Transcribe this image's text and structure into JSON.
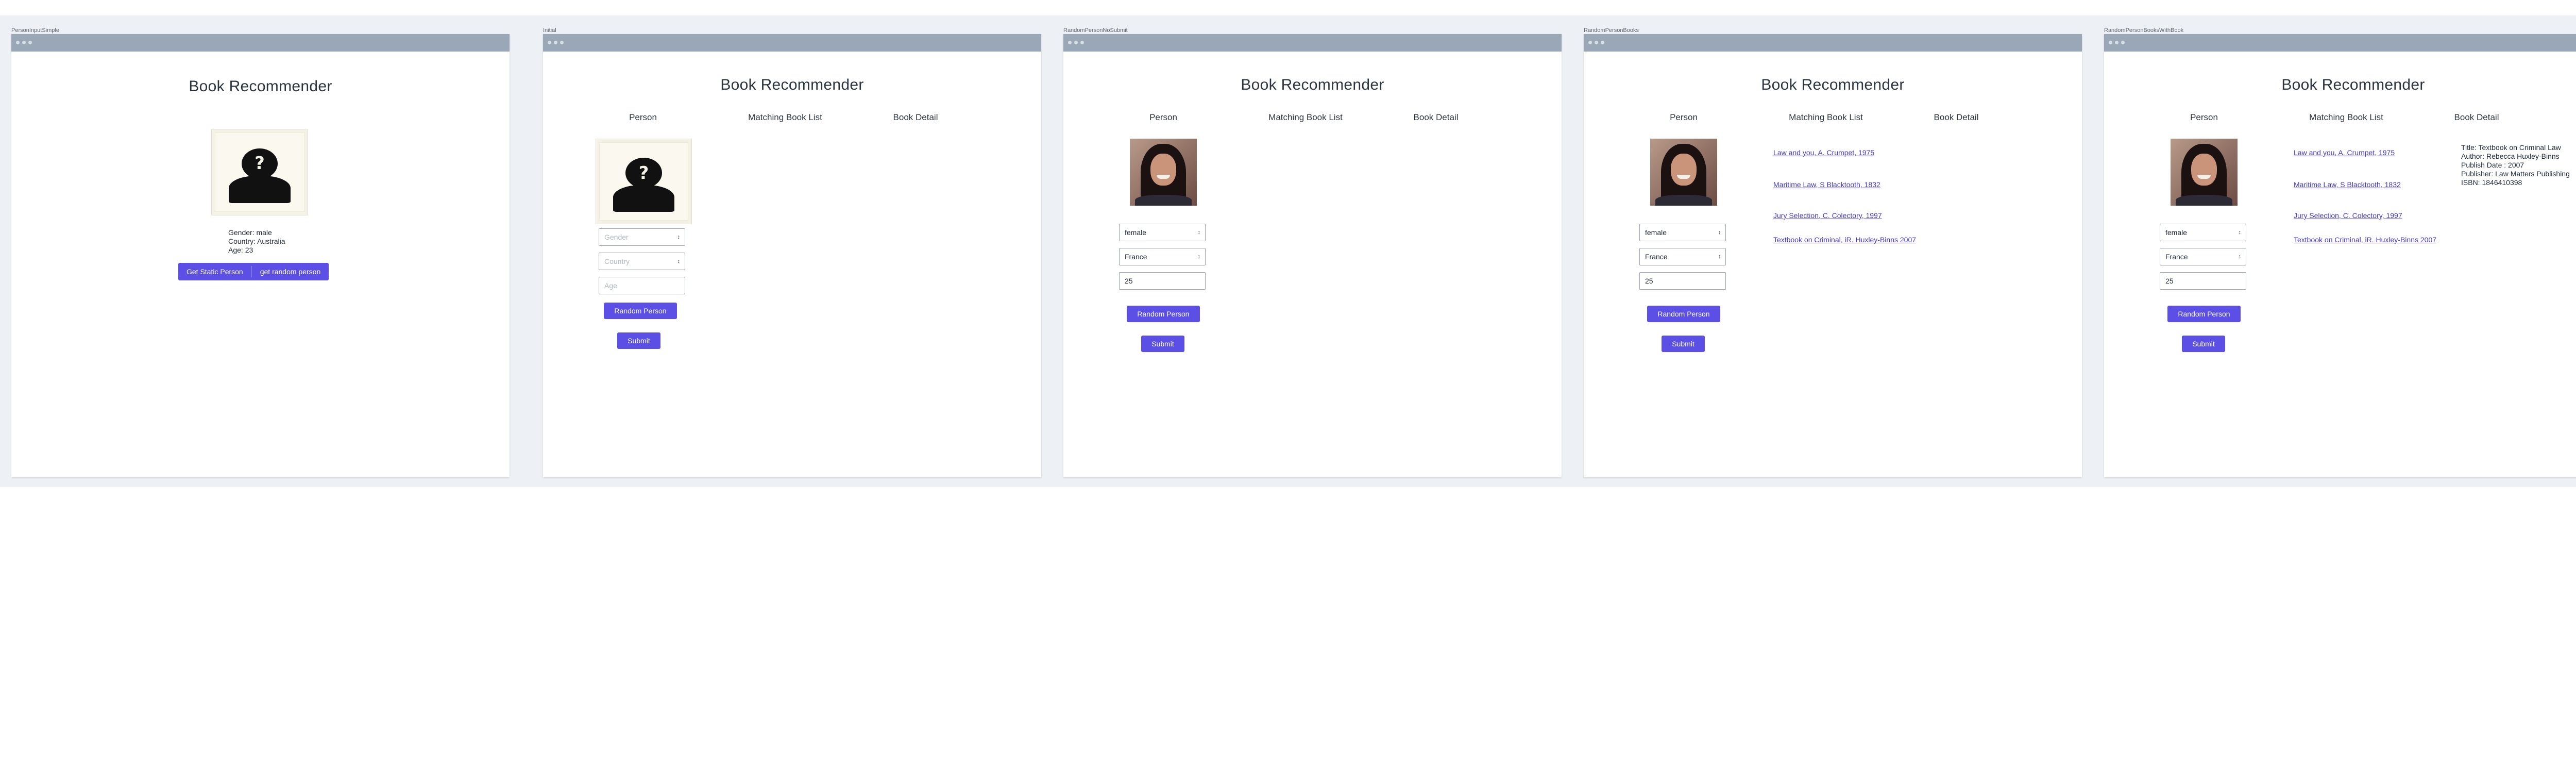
{
  "frames": [
    {
      "label": "PersonInputSimple",
      "title": "Book Recommender",
      "person": {
        "gender_line": "Gender: male",
        "country_line": "Country: Australia",
        "age_line": "Age: 23"
      },
      "buttons": {
        "static": "Get Static Person",
        "random": "get random person"
      }
    },
    {
      "label": "Initial",
      "title": "Book Recommender",
      "headers": {
        "person": "Person",
        "list": "Matching Book List",
        "detail": "Book Detail"
      },
      "form": {
        "gender_placeholder": "Gender",
        "country_placeholder": "Country",
        "age_placeholder": "Age"
      },
      "buttons": {
        "random": "Random Person",
        "submit": "Submit"
      }
    },
    {
      "label": "RandomPersonNoSubmit",
      "title": "Book Recommender",
      "headers": {
        "person": "Person",
        "list": "Matching Book List",
        "detail": "Book Detail"
      },
      "form": {
        "gender": "female",
        "country": "France",
        "age": "25"
      },
      "buttons": {
        "random": "Random Person",
        "submit": "Submit"
      }
    },
    {
      "label": "RandomPersonBooks",
      "title": "Book Recommender",
      "headers": {
        "person": "Person",
        "list": "Matching Book List",
        "detail": "Book Detail"
      },
      "form": {
        "gender": "female",
        "country": "France",
        "age": "25"
      },
      "buttons": {
        "random": "Random Person",
        "submit": "Submit"
      },
      "books": [
        "Law and you, A. Crumpet, 1975",
        "Maritime Law, S Blacktooth, 1832",
        "Jury Selection, C. Colectory, 1997",
        "Textbook on Criminal, iR. Huxley-Binns 2007"
      ]
    },
    {
      "label": "RandomPersonBooksWithBook",
      "title": "Book Recommender",
      "headers": {
        "person": "Person",
        "list": "Matching Book List",
        "detail": "Book Detail"
      },
      "form": {
        "gender": "female",
        "country": "France",
        "age": "25"
      },
      "buttons": {
        "random": "Random Person",
        "submit": "Submit"
      },
      "books": [
        "Law and you, A. Crumpet, 1975",
        "Maritime Law, S Blacktooth, 1832",
        "Jury Selection, C. Colectory, 1997",
        "Textbook on Criminal, iR. Huxley-Binns 2007"
      ],
      "detail": {
        "title": "Title: Textbook on Criminal Law",
        "author": "Author: Rebecca Huxley-Binns",
        "publish_date": "Publish Date : 2007",
        "publisher": "Publisher: Law Matters Publishing",
        "isbn": "ISBN: 1846410398"
      }
    }
  ],
  "icons": {
    "placeholder_photo": "unknown-person-silhouette-icon",
    "select_caret": "updown-caret-icon"
  },
  "colors": {
    "accent": "#5b4fe6",
    "canvas": "#edf1f5",
    "chrome": "#9aa7b6",
    "link": "#4338ca"
  }
}
